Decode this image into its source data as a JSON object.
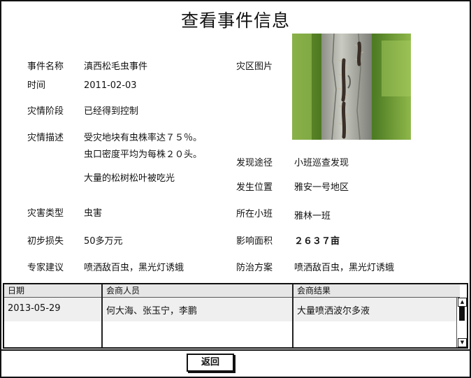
{
  "title": "查看事件信息",
  "fields": {
    "event_name_label": "事件名称",
    "event_name": "滇西松毛虫事件",
    "time_label": "时间",
    "time": "2011-02-03",
    "stage_label": "灾情阶段",
    "stage": "已经得到控制",
    "desc_label": "灾情描述",
    "desc_line1": "受灾地块有虫株率达７５％。",
    "desc_line2": "虫口密度平均为每株２０头。",
    "desc_line3": "大量的松树松叶被吃光",
    "image_label": "灾区图片",
    "discovery_label": "发现途径",
    "discovery": "小班巡查发现",
    "location_label": "发生位置",
    "location": "雅安一号地区",
    "type_label": "灾害类型",
    "type": "虫害",
    "area_label": "所在小班",
    "area": "雅林一班",
    "loss_label": "初步损失",
    "loss": "50多万元",
    "impact_label": "影响面积",
    "impact": "２６３７亩",
    "advice_label": "专家建议",
    "advice": "喷洒敌百虫，黑光灯诱蛾",
    "plan_label": "防治方案",
    "plan": "喷洒敌百虫，黑光灯诱蛾"
  },
  "table": {
    "headers": [
      "日期",
      "会商人员",
      "会商结果"
    ],
    "rows": [
      [
        "2013-05-29",
        "何大海、张玉宁，李鹏",
        "大量喷洒波尔多液"
      ]
    ]
  },
  "back_button": "返回",
  "icons": {
    "scroll_up": "scroll-up-arrow",
    "scroll_down": "scroll-down-arrow"
  }
}
